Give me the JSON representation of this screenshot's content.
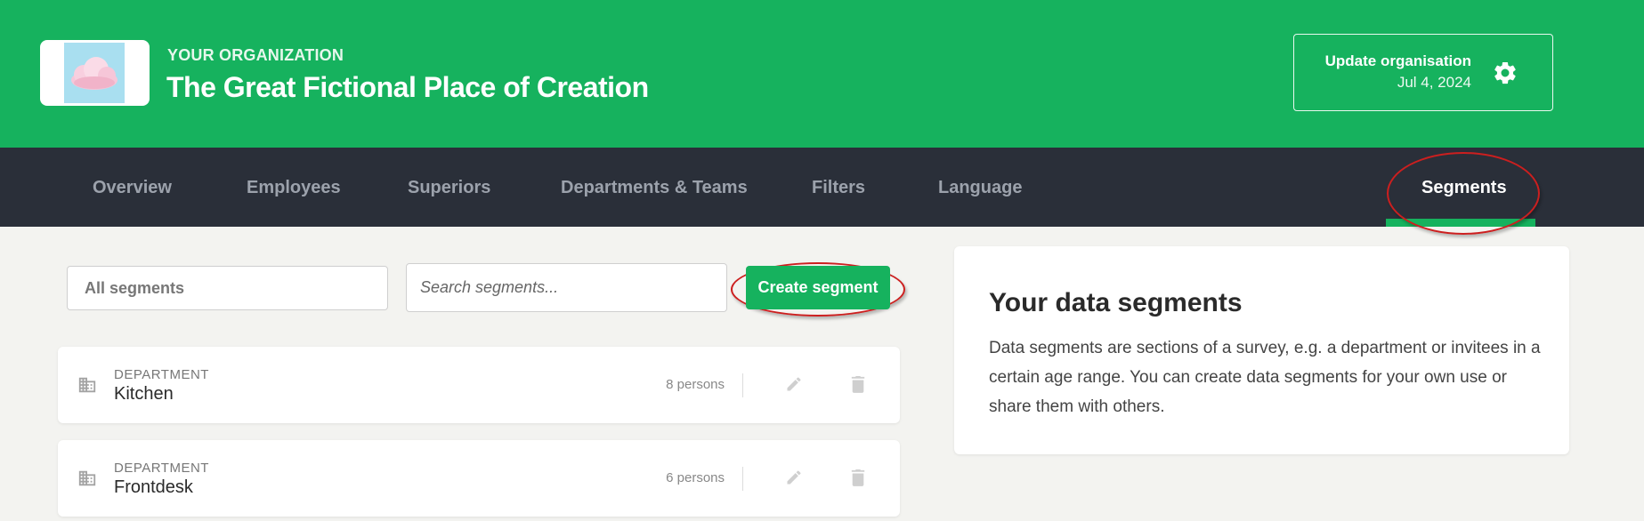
{
  "header": {
    "org_label": "YOUR ORGANIZATION",
    "org_name": "The Great Fictional Place of Creation",
    "update_title": "Update organisation",
    "update_date": "Jul 4, 2024"
  },
  "nav": {
    "items": [
      {
        "label": "Overview"
      },
      {
        "label": "Employees"
      },
      {
        "label": "Superiors"
      },
      {
        "label": "Departments & Teams"
      },
      {
        "label": "Filters"
      },
      {
        "label": "Language"
      },
      {
        "label": "Segments"
      }
    ],
    "active": "Segments"
  },
  "toolbar": {
    "select_value": "All segments",
    "search_placeholder": "Search segments...",
    "create_label": "Create segment"
  },
  "segments": [
    {
      "type": "DEPARTMENT",
      "name": "Kitchen",
      "count": "8 persons"
    },
    {
      "type": "DEPARTMENT",
      "name": "Frontdesk",
      "count": "6 persons"
    }
  ],
  "info": {
    "title": "Your data segments",
    "text": "Data segments are sections of a survey, e.g. a department or invitees in a certain age range. You can create data segments for your own use or share them with others."
  },
  "colors": {
    "brand_green": "#16b25e",
    "nav_bg": "#2a2f39",
    "page_bg": "#f3f3f0",
    "annotation_red": "#cc1f1f"
  },
  "icons": {
    "logo": "cloud-logo-icon",
    "update": "gear-icon",
    "segment": "building-icon",
    "edit": "pencil-icon",
    "delete": "trash-icon"
  }
}
